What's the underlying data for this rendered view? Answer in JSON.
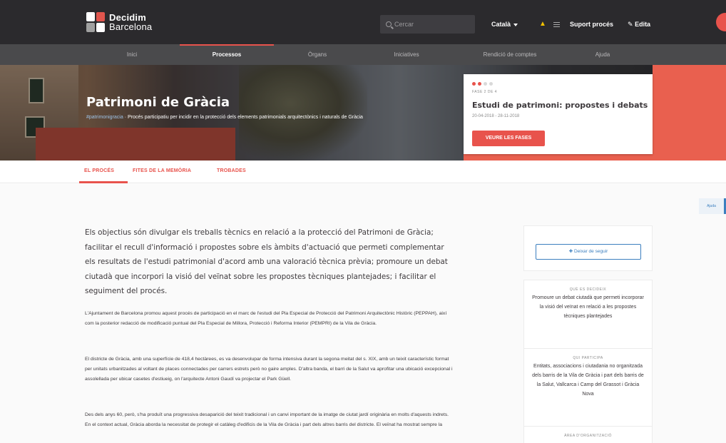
{
  "header": {
    "logo_line1": "Decidim",
    "logo_line2": "Barcelona",
    "search_placeholder": "Cercar",
    "language": "Català",
    "support_label": "Suport procés",
    "edit_label": "Edita"
  },
  "nav": {
    "items": [
      {
        "label": "Inici"
      },
      {
        "label": "Processos"
      },
      {
        "label": "Òrgans"
      },
      {
        "label": "Iniciatives"
      },
      {
        "label": "Rendició de comptes"
      },
      {
        "label": "Ajuda"
      }
    ],
    "active_index": 1
  },
  "hero": {
    "title": "Patrimoni de Gràcia",
    "hashtag": "#patrimonigracia",
    "separator": "·",
    "subtitle": "Procés participatiu per incidir en la protecció dels elements patrimonials arquitectònics i naturals de Gràcia"
  },
  "phase": {
    "steps_total": 4,
    "steps_active": 2,
    "label": "FASE 2 DE 4",
    "title": "Estudi de patrimoni: propostes i debats",
    "dates": "20-04-2018 - 28-11-2018",
    "button": "VEURE LES FASES"
  },
  "tabs": [
    {
      "label": "EL PROCÉS"
    },
    {
      "label": "FITES DE LA MEMÒRIA"
    },
    {
      "label": "TROBADES"
    }
  ],
  "help_tab": "Ajuda",
  "content": {
    "lead": "Els objectius són divulgar els treballs tècnics en relació a la protecció del Patrimoni de Gràcia; facilitar el recull d'informació i propostes sobre els àmbits d'actuació que permeti complementar els resultats de l'estudi patrimonial d'acord amb una valoració tècnica prèvia; promoure un debat ciutadà que incorpori la visió del veïnat sobre les propostes tècniques plantejades; i facilitar el seguiment del procés.",
    "paragraphs": [
      "L'Ajuntament de Barcelona promou aquest procés de participació en el marc de l'estudi del Pla Especial de Protecció del Patrimoni Arquitectònic Històric (PEPPAH), així com la posterior redacció de modificació puntual del Pla Especial de Millora, Protecció i Reforma Interior (PEMPRI) de la Vila de Gràcia.",
      "El districte de Gràcia, amb una superfície de 418,4 hectàrees, es va desenvolupar de forma intensiva durant la segona meitat del s. XIX, amb un teixit característic format per unitats urbanitzades al voltant de places connectades per carrers estrets però no gaire amples. D'altra banda, el barri de la Salut va aprofitar una ubicació excepcional i assolellada per ubicar casetes d'estiueig, on l'arquitecte Antoni Gaudí va projectar el Park Güell.",
      "Des dels anys 60, però, s'ha produït una progressiva desaparició del teixit tradicional i un canvi important de la imatge de ciutat jardí originària en molts d'aquests indrets. En el context actual, Gràcia aborda la necessitat de protegir el catàleg d'edificis de la Vila de Gràcia i part dels altres barris del districte. El veïnat ha mostrat sempre la"
    ]
  },
  "sidebar": {
    "follow_button": "Deixar de seguir",
    "boxes": [
      {
        "head": "QUÈ ES DECIDEIX",
        "text": "Promoure un debat ciutadà que permeti incorporar la visió del veïnat en relació a les propostes tècniques plantejades"
      },
      {
        "head": "QUI PARTICIPA",
        "text": "Entitats, associacions i ciutadania no organitzada dels barris de la Vila de Gràcia i part dels barris de la Salut, Vallcarca i Camp del Grassot i Gràcia Nova"
      },
      {
        "head": "ÀREA D'ORGANITZACIÓ",
        "text": ""
      }
    ]
  },
  "colors": {
    "topbar": "#2b2a2d",
    "nav": "#4a4a4c",
    "accent": "#e8534c",
    "link": "#3c7fbf",
    "warning_icon": "#f2c100"
  },
  "icons": [
    "search-icon",
    "caret-down-icon",
    "bell-icon",
    "menu-icon",
    "pencil-icon",
    "plus-icon"
  ]
}
